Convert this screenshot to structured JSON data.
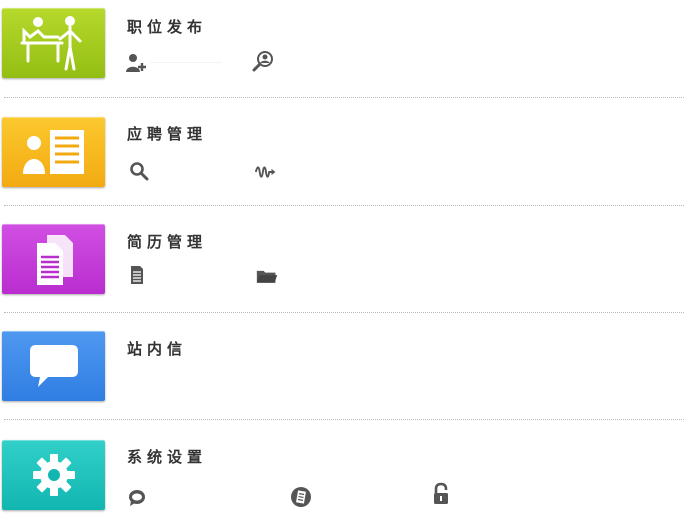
{
  "sections": [
    {
      "title": "职位发布",
      "tile_color": "#9ec81a",
      "icon": "people-desk-icon",
      "actions": [
        {
          "icon": "add-user-icon"
        },
        {
          "icon": "search-person-icon"
        }
      ]
    },
    {
      "title": "应聘管理",
      "tile_color": "#f6b91b",
      "icon": "id-card-icon",
      "actions": [
        {
          "icon": "magnifier-icon"
        },
        {
          "icon": "wave-arrow-icon"
        }
      ]
    },
    {
      "title": "简历管理",
      "tile_color": "#c239d7",
      "icon": "documents-icon",
      "actions": [
        {
          "icon": "document-icon"
        },
        {
          "icon": "folder-icon"
        }
      ]
    },
    {
      "title": "站内信",
      "tile_color": "#3b8ae8",
      "icon": "speech-bubble-icon",
      "actions": []
    },
    {
      "title": "系统设置",
      "tile_color": "#1ec4be",
      "icon": "gear-icon",
      "actions": [
        {
          "icon": "chat-bubble-icon"
        },
        {
          "icon": "notes-icon"
        },
        {
          "icon": "lock-icon"
        }
      ]
    }
  ]
}
